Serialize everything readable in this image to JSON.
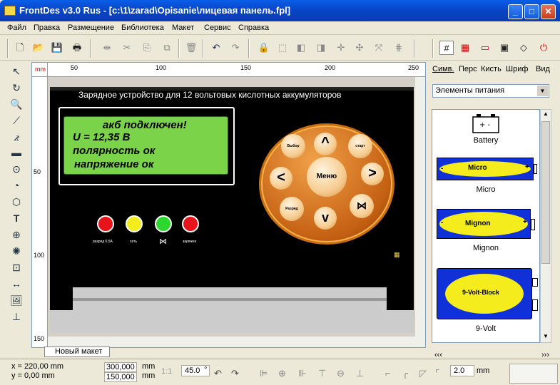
{
  "window": {
    "title": "FrontDes v3.0 Rus - [c:\\1\\zarad\\Opisanie\\лицевая панель.fpl]",
    "minimize": "_",
    "maximize": "□",
    "close": "✕"
  },
  "menu": [
    "Файл",
    "Правка",
    "Размещение",
    "Библиотека",
    "Макет",
    "Сервис",
    "Справка"
  ],
  "ruler": {
    "unit": "mm",
    "top": [
      "50",
      "100",
      "150",
      "200",
      "250"
    ],
    "left": [
      "50",
      "100",
      "150"
    ]
  },
  "panel": {
    "title": "Зарядное устройство для 12 вольтовых кислотных аккумуляторов",
    "lcd": [
      "акб подключен!",
      "U = 12,35 В",
      "полярность ок",
      "напряжение ок"
    ],
    "leds": [
      {
        "color": "#e8141c",
        "label": "разряд 0,5А"
      },
      {
        "color": "#f4ec1c",
        "label": "сеть"
      },
      {
        "color": "#2cd82c",
        "label": ""
      },
      {
        "color": "#e8141c",
        "label": "заряжен"
      }
    ],
    "knob": {
      "center": "Меню",
      "up": "^",
      "down": "v",
      "left": "<",
      "right": ">",
      "top_left": "Выбор",
      "top_right": "старт",
      "bottom_left": "Разряд",
      "bottom_right": "symbol"
    }
  },
  "sheet_tab": "Новый макет",
  "right_panel": {
    "tabs": [
      "Симв.",
      "Перс",
      "Кисть",
      "Шриф",
      "Вид"
    ],
    "library": "Элементы питания",
    "items": [
      {
        "label": "Battery",
        "text": "+  -"
      },
      {
        "label": "Micro",
        "text": "Micro"
      },
      {
        "label": "Mignon",
        "text": "Mignon"
      },
      {
        "label": "9-Volt",
        "text": "9-Volt-Block"
      }
    ],
    "nav_left": "‹‹‹",
    "nav_right": "›››"
  },
  "status": {
    "x": "x = 220,00 mm",
    "y": "y = 0,00 mm",
    "width": "300,000",
    "height": "150,000",
    "unit": "mm",
    "unit2": "mm",
    "scale": "1:1",
    "angle": "45.0",
    "angle_unit": "°",
    "stroke": "2.0",
    "stroke_unit": "mm"
  },
  "colors": {
    "lcd": "#7bd34a",
    "knob": "#e07a20",
    "panel": "#000000",
    "title_bar": "#0a5ee8"
  }
}
